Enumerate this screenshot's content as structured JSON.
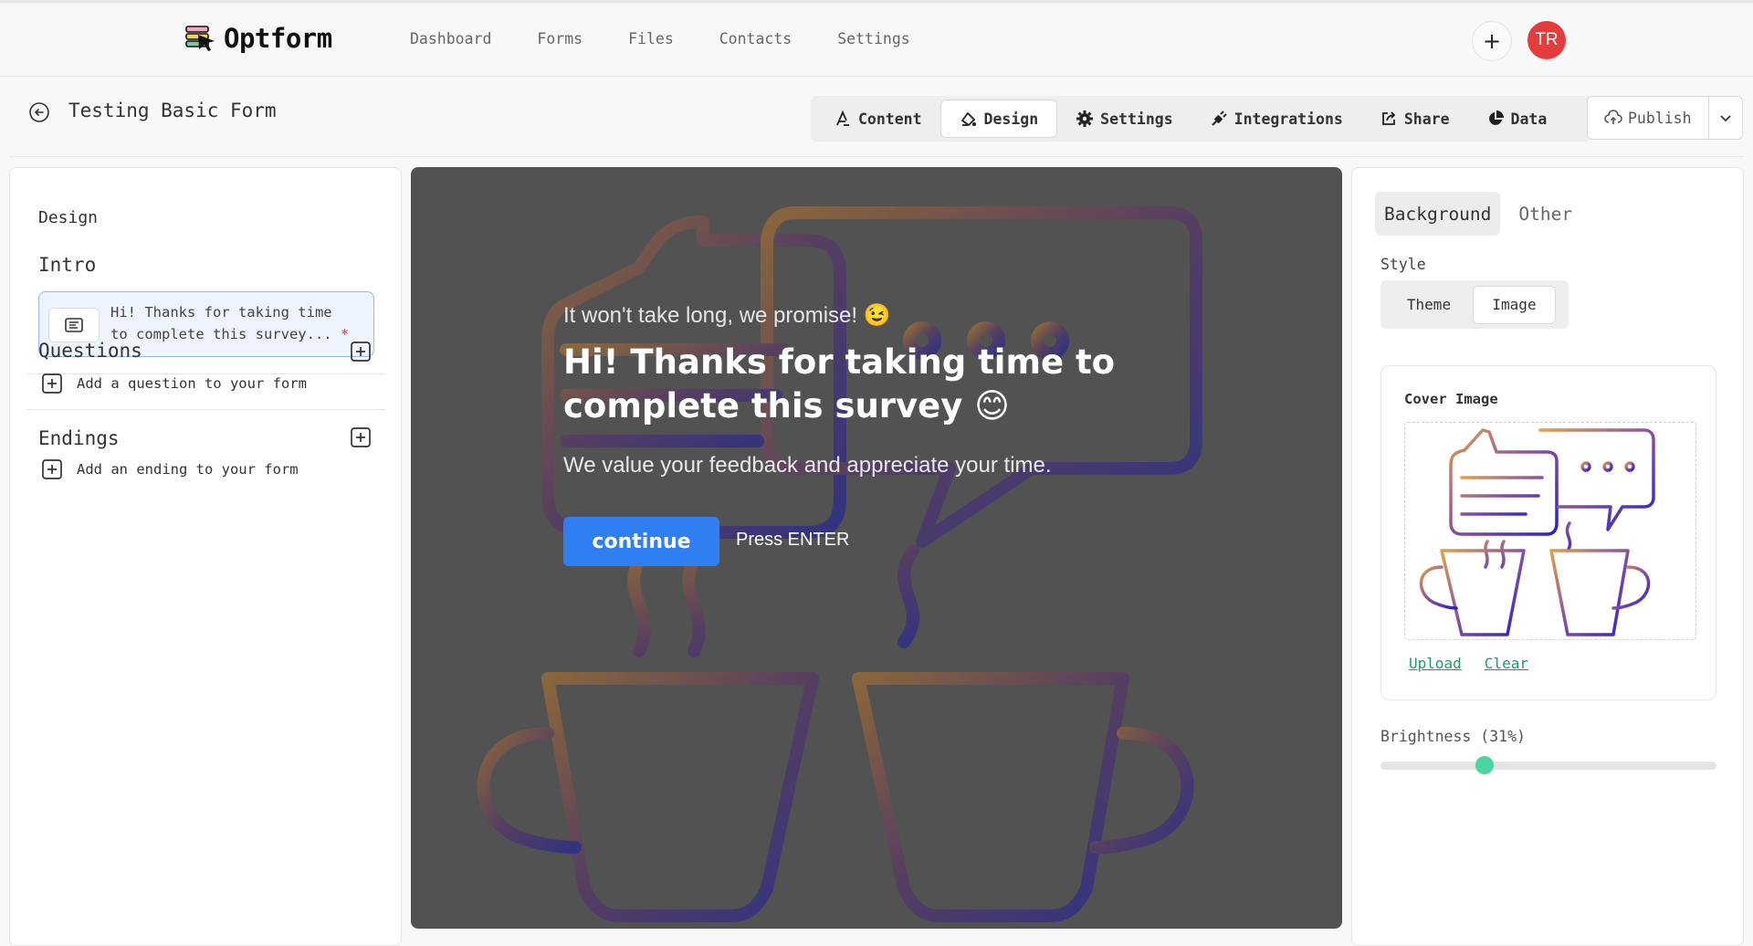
{
  "app": {
    "name": "Optform",
    "nav": [
      "Dashboard",
      "Forms",
      "Files",
      "Contacts",
      "Settings"
    ],
    "avatar_initials": "TR",
    "avatar_color": "#e63b3b"
  },
  "editor": {
    "form_title": "Testing Basic Form",
    "tabs": [
      {
        "label": "Content",
        "icon": "content-icon"
      },
      {
        "label": "Design",
        "icon": "design-icon",
        "active": true
      },
      {
        "label": "Settings",
        "icon": "gear-icon"
      },
      {
        "label": "Integrations",
        "icon": "plug-icon"
      },
      {
        "label": "Share",
        "icon": "share-icon"
      },
      {
        "label": "Data",
        "icon": "pie-chart-icon"
      }
    ],
    "publish_label": "Publish"
  },
  "left_panel": {
    "heading": "Design",
    "intro": {
      "title": "Intro",
      "card_text": "Hi! Thanks for taking time to complete this survey...",
      "required_mark": "*"
    },
    "questions": {
      "title": "Questions",
      "add_label": "Add a question to your form"
    },
    "endings": {
      "title": "Endings",
      "add_label": "Add an ending to your form"
    }
  },
  "preview": {
    "tagline": "It won't take long, we promise! 😉",
    "title": "Hi! Thanks for taking time to complete this survey 😊",
    "subtitle": "We value your feedback and appreciate your time.",
    "button_label": "continue",
    "hint": "Press ENTER"
  },
  "right_panel": {
    "tabs": [
      {
        "label": "Background",
        "active": true
      },
      {
        "label": "Other"
      }
    ],
    "style_label": "Style",
    "style_options": [
      {
        "label": "Theme"
      },
      {
        "label": "Image",
        "active": true
      }
    ],
    "cover_image_label": "Cover Image",
    "upload_label": "Upload",
    "clear_label": "Clear",
    "brightness_label": "Brightness (31%)",
    "brightness_value": 31,
    "accent_color": "#4ed3a2"
  }
}
